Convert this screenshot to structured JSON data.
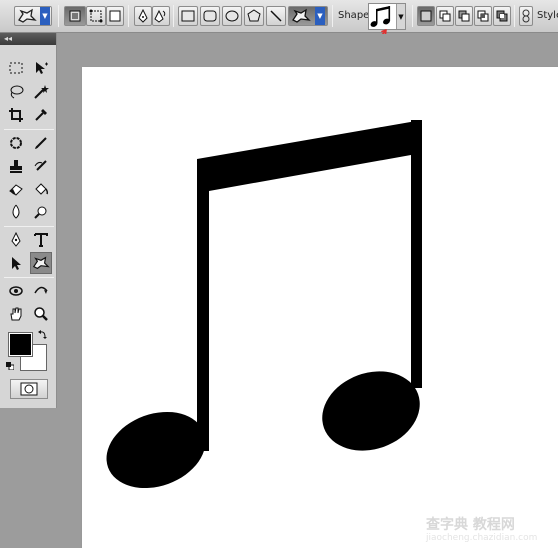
{
  "options_bar": {
    "shape_label": "Shape:",
    "style_label": "Style",
    "selected_shape": "music-note"
  },
  "tools": {
    "header": "◂◂"
  },
  "colors": {
    "foreground": "#000000",
    "background": "#ffffff",
    "highlight_arrow": "#e03030"
  },
  "watermark": {
    "text": "查字典 教程网",
    "url": "jiaocheng.chazidian.com"
  }
}
